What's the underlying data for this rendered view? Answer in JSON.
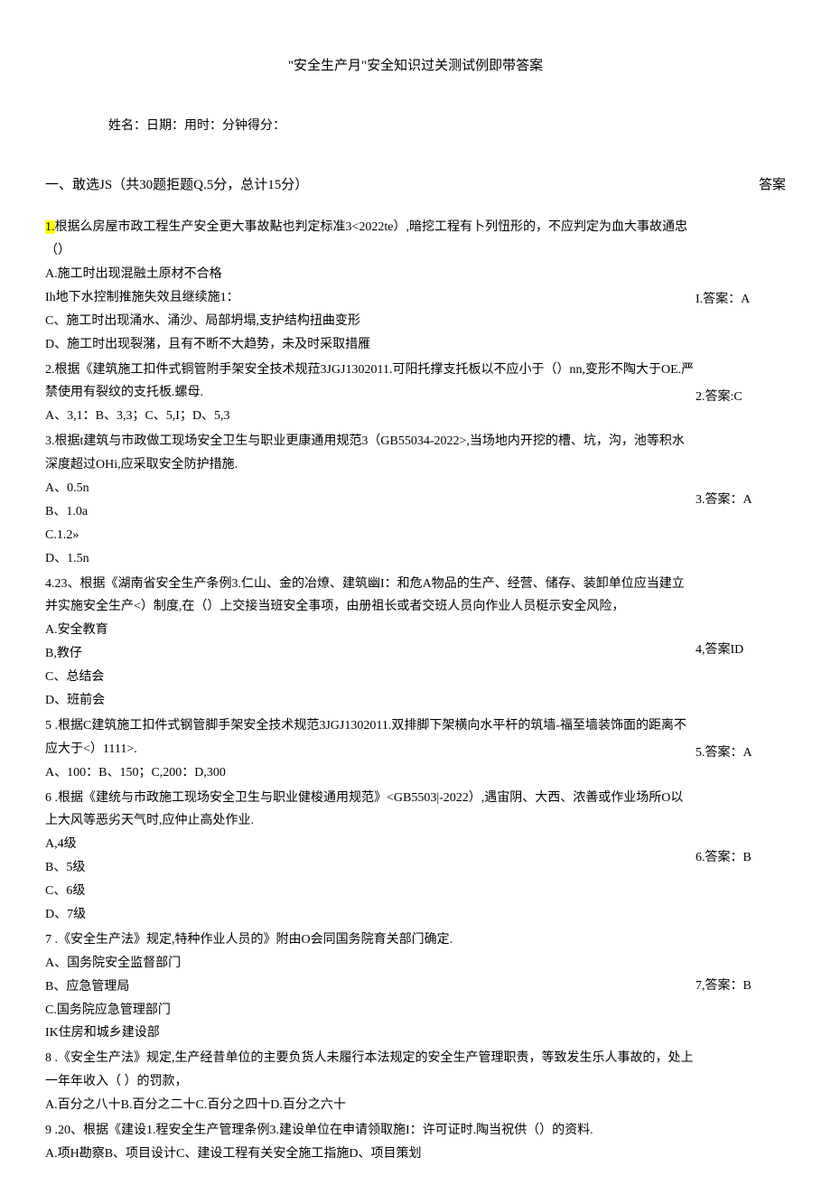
{
  "title": "\"安全生产月\"安全知识过关测试例即带答案",
  "info_line": "姓名：日期：用时：分钟得分：",
  "section_header": "一、敢选JS（共30题拒题Q.5分，总计15分）",
  "answer_header": "答案",
  "questions": {
    "q1_marker": "1.",
    "q1_text": "根据么房屋市政工程生产安全更大事故黇也判定标准3<2022te）,暗挖工程有卜列忸形的，不应判定为血大事故通忠（）",
    "q1_a": "A.施工时出现混融土原材不合格",
    "q1_b": "Ih地下水控制推施失效且继续施1：",
    "q1_c": "C、施工时出现涌水、涌沙、局部坍塌,支护结构扭曲变形",
    "q1_d": "D、施工时出现裂潴，且有不断不大趋势，未及时采取措雁",
    "q2_text": "2.根据《建筑施工扣件式铜管附手架安全技术规菈3JGJ1302011.可阳托撑支托板以不应小于（）nn,变形不陶大于OE.严禁使用有裂纹的支托板.螺母.",
    "q2_opts": "A、3,1：B、3,3；C、5,I；D、5,3",
    "q3_text": "3.根据t建筑与市政做工现场安全卫生与职业更康通用规范3（GB55034-2022>,当场地内开挖的槽、坑，沟，池等积水深度超过OHi,应采取安全防护措施.",
    "q3_a": "A、0.5n",
    "q3_b": "B、1.0a",
    "q3_c": "C.1.2»",
    "q3_d": "D、1.5n",
    "q4_text": "4.23、根据《湖南省安全生产条例3.仁山、金的冶燎、建筑幽I：和危A物品的生产、经营、储存、装卸单位应当建立并实施安全生产<）制度,在（）上交接当班安全事项，由册祖长或者交班人员向作业人员梃示安全风险，",
    "q4_a": "A.安全教育",
    "q4_b": "B,教仔",
    "q4_c": "C、总结会",
    "q4_d": "D、班前会",
    "q5_text": "5   .根据C建筑施工扣件式钢管脚手架安全技术规范3JGJ1302011.双排脚下架横向水平杆的筑墙-福至墙装饰面的距离不应大于<）1111>.",
    "q5_opts": "A、100：B、150；C,200：D,300",
    "q6_text": "6   .根据《建统与市政施工现场安全卫生与职业健梭通用规范》<GB5503|-2022）,遇宙阴、大西、浓善或作业场所O以上大风等恶劣天气时,应仲止高处作业.",
    "q6_a": "A,4级",
    "q6_b": "B、5级",
    "q6_c": "C、6级",
    "q6_d": "D、7级",
    "q7_text": "7   .《安全生产法》规定,特种作业人员的》附由O会同国务院育关部门确定.",
    "q7_a": "A、国务院安全监督部门",
    "q7_b": "B、应急管理局",
    "q7_c": "C.国务院应急管理部门",
    "q7_d": "IK住房和城乡建设部",
    "q8_text": "8   .《安全生产法》规定,生产经昔单位的主要负货人未履行本法规定的安全生产管理职责，等致发生乐人事故的，处上一年年收入（                          ）的罚款，",
    "q8_opts": "A.百分之八十B.百分之二十C.百分之四十D.百分之六十",
    "q9_text": "9   .20、根据《建设1.程安全生产管理条例3.建设单位在申请领取施I：许可证时.陶当祝供（）的资料.",
    "q9_opts": "A.项H勘察B、项目设计C、建设工程有关安全施工指施D、项目策划"
  },
  "answers": {
    "a1": "I.答案：A",
    "a2": "2.答案:C",
    "a3": "3.答案：A",
    "a4": "4,答案ID",
    "a5": "5.答案：A",
    "a6": "6.答案：B",
    "a7": "7,答案：B"
  }
}
